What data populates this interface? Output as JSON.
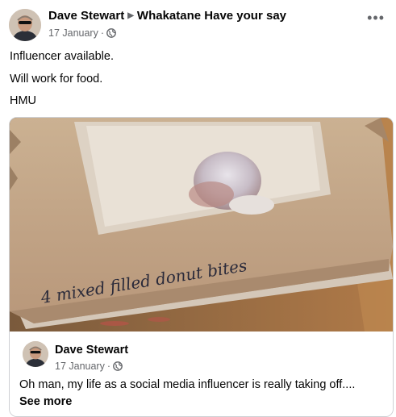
{
  "post": {
    "author": "Dave Stewart",
    "group": "Whakatane Have your say",
    "date": "17 January",
    "separator": "·",
    "privacy_icon": "globe-icon",
    "more_icon": "more-options-icon",
    "more_glyph": "•••",
    "lines": [
      "Influencer available.",
      "Will work for food.",
      "HMU"
    ]
  },
  "photo": {
    "handwriting": "4 mixed filled donut bites"
  },
  "shared_post": {
    "author": "Dave Stewart",
    "date": "17 January",
    "separator": "·",
    "text": "Oh man,  my life as a social media influencer is really taking off....",
    "see_more": "See more"
  },
  "colors": {
    "text": "#050505",
    "secondary": "#65676b",
    "border": "#ced0d4"
  }
}
